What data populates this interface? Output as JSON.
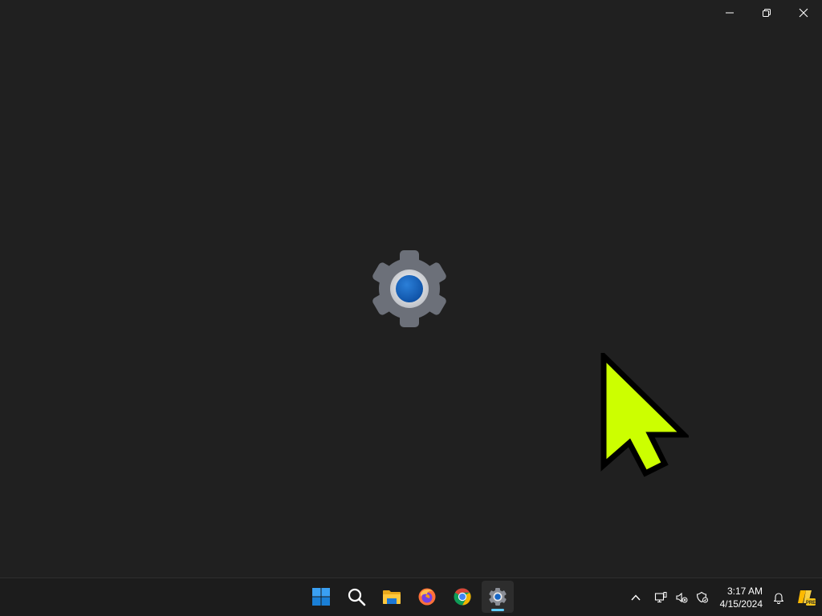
{
  "window": {
    "minimize_icon": "minimize-icon",
    "restore_icon": "restore-icon",
    "close_icon": "close-icon"
  },
  "splash": {
    "icon": "settings-gear-icon"
  },
  "taskbar": {
    "apps": [
      {
        "name": "start",
        "icon": "windows-logo-icon",
        "active": false
      },
      {
        "name": "search",
        "icon": "search-icon",
        "active": false
      },
      {
        "name": "file-explorer",
        "icon": "folder-icon",
        "active": false
      },
      {
        "name": "firefox",
        "icon": "firefox-icon",
        "active": false
      },
      {
        "name": "chrome",
        "icon": "chrome-icon",
        "active": false
      },
      {
        "name": "settings",
        "icon": "settings-gear-icon",
        "active": true
      }
    ],
    "tray": {
      "show_hidden_icon": "chevron-up-icon",
      "network_icon": "network-icon",
      "volume_icon": "volume-muted-icon",
      "security_icon": "security-icon",
      "time": "3:17 AM",
      "date": "4/15/2024",
      "notification_icon": "bell-icon",
      "copilot_icon": "copilot-pre-icon"
    }
  },
  "colors": {
    "background": "#202020",
    "taskbar": "#1c1c1c",
    "accent": "#60cdff",
    "cursor": "#ccff00"
  }
}
